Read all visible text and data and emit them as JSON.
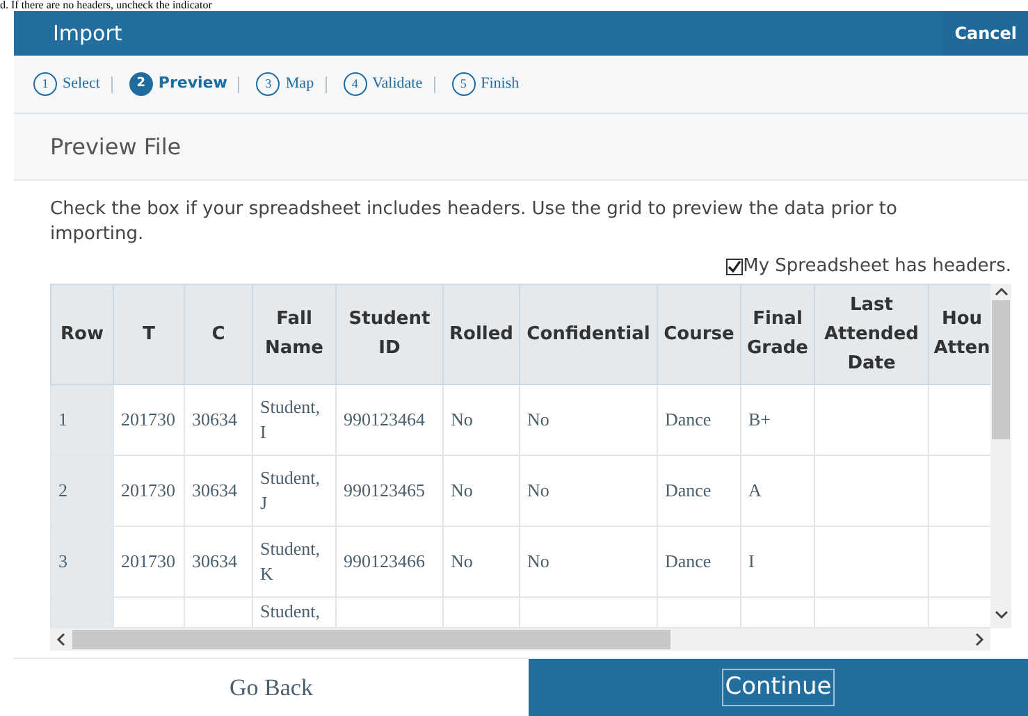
{
  "banner_text": "d. If there are no headers, uncheck the indicator",
  "dialog": {
    "title": "Import",
    "cancel": "Cancel"
  },
  "steps": [
    {
      "number": "1",
      "label": "Select",
      "selected": false
    },
    {
      "number": "2",
      "label": "Preview",
      "selected": true
    },
    {
      "number": "3",
      "label": "Map",
      "selected": false
    },
    {
      "number": "4",
      "label": "Validate",
      "selected": false
    },
    {
      "number": "5",
      "label": "Finish",
      "selected": false
    }
  ],
  "section_title": "Preview File",
  "description": "Check the box if your spreadsheet includes headers. Use the grid to preview the data prior to importing.",
  "headers_checkbox": {
    "label": "My Spreadsheet has headers.",
    "checked": true
  },
  "table": {
    "columns": [
      "Row",
      "T",
      "C",
      "Fall Name",
      "Student ID",
      "Rolled",
      "Confidential",
      "Course",
      "Final Grade",
      "Last Attended Date",
      "Hou Atten"
    ],
    "rows": [
      [
        "1",
        "201730",
        "30634",
        "Student, I",
        "990123464",
        "No",
        "No",
        "Dance",
        "B+",
        "",
        ""
      ],
      [
        "2",
        "201730",
        "30634",
        "Student, J",
        "990123465",
        "No",
        "No",
        "Dance",
        "A",
        "",
        ""
      ],
      [
        "3",
        "201730",
        "30634",
        "Student, K",
        "990123466",
        "No",
        "No",
        "Dance",
        "I",
        "",
        ""
      ],
      [
        "",
        "",
        "",
        "Student,",
        "",
        "",
        "",
        "",
        "",
        "",
        ""
      ]
    ]
  },
  "buttons": {
    "back": "Go Back",
    "continue": "Continue"
  }
}
